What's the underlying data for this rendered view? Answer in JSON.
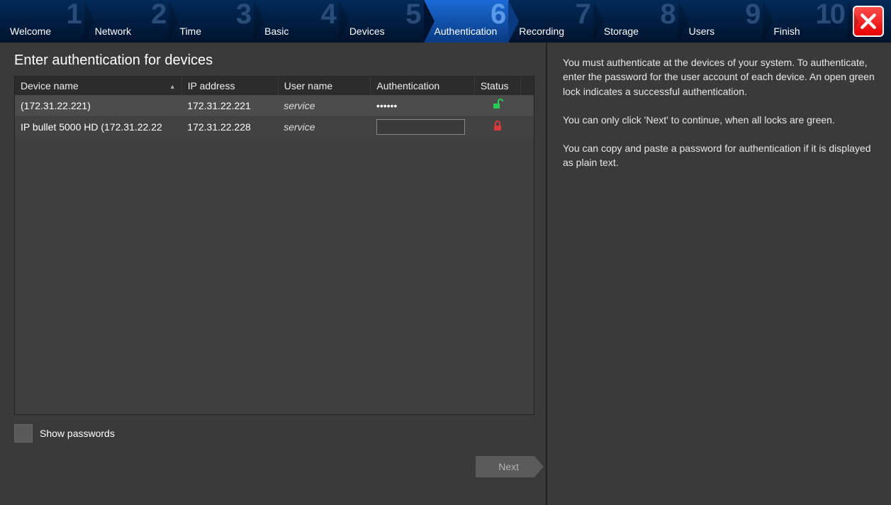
{
  "stepper": {
    "steps": [
      {
        "num": "1",
        "label": "Welcome"
      },
      {
        "num": "2",
        "label": "Network"
      },
      {
        "num": "3",
        "label": "Time"
      },
      {
        "num": "4",
        "label": "Basic"
      },
      {
        "num": "5",
        "label": "Devices"
      },
      {
        "num": "6",
        "label": "Authentication",
        "active": true
      },
      {
        "num": "7",
        "label": "Recording"
      },
      {
        "num": "8",
        "label": "Storage"
      },
      {
        "num": "9",
        "label": "Users"
      },
      {
        "num": "10",
        "label": "Finish"
      }
    ]
  },
  "page": {
    "title": "Enter authentication for devices",
    "show_passwords_label": "Show passwords",
    "next_label": "Next"
  },
  "table": {
    "headers": {
      "name": "Device name",
      "ip": "IP address",
      "user": "User name",
      "auth": "Authentication",
      "status": "Status"
    },
    "rows": [
      {
        "name": " (172.31.22.221)",
        "ip": "172.31.22.221",
        "user": "service",
        "auth_value": "••••••",
        "status": "unlocked"
      },
      {
        "name": "IP bullet 5000 HD (172.31.22.22",
        "ip": "172.31.22.228",
        "user": "service",
        "auth_value": "",
        "status": "locked"
      }
    ]
  },
  "help": {
    "p1": "You must authenticate at the devices of your system. To authenticate, enter the password for the user account of each device. An open green lock indicates a successful authentication.",
    "p2": "You can only click 'Next' to continue, when all locks are green.",
    "p3": "You can copy and paste a password for authentication if it is displayed as plain text."
  }
}
